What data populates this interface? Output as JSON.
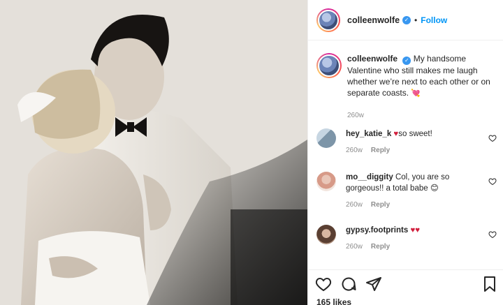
{
  "post": {
    "username": "colleenwolfe",
    "follow_label": "Follow",
    "dot": "•",
    "caption": {
      "username": "colleenwolfe",
      "text": "My handsome Valentine who still makes me laugh whether we’re next to each other or on separate coasts.",
      "emoji": "💘",
      "age": "260w"
    },
    "comments": [
      {
        "username": "hey_katie_k",
        "emoji": "♥",
        "text": "so sweet!",
        "age": "260w",
        "reply": "Reply"
      },
      {
        "username": "mo__diggity",
        "text": "Col, you are so gorgeous!! a total babe",
        "emoji": "😊",
        "age": "260w",
        "reply": "Reply"
      },
      {
        "username": "gypsy.footprints",
        "emoji": "♥♥",
        "age": "260w",
        "reply": "Reply"
      }
    ],
    "likes": "165 likes"
  },
  "icons": {
    "verified": "verified-badge-icon",
    "like": "heart-outline-icon",
    "comment": "comment-bubble-icon",
    "share": "paper-plane-icon",
    "save": "bookmark-icon"
  },
  "colors": {
    "accent": "#0095f6",
    "verified": "#3897f0",
    "heart": "#d11e3c",
    "text": "#262626",
    "muted": "#8e8e8e"
  }
}
